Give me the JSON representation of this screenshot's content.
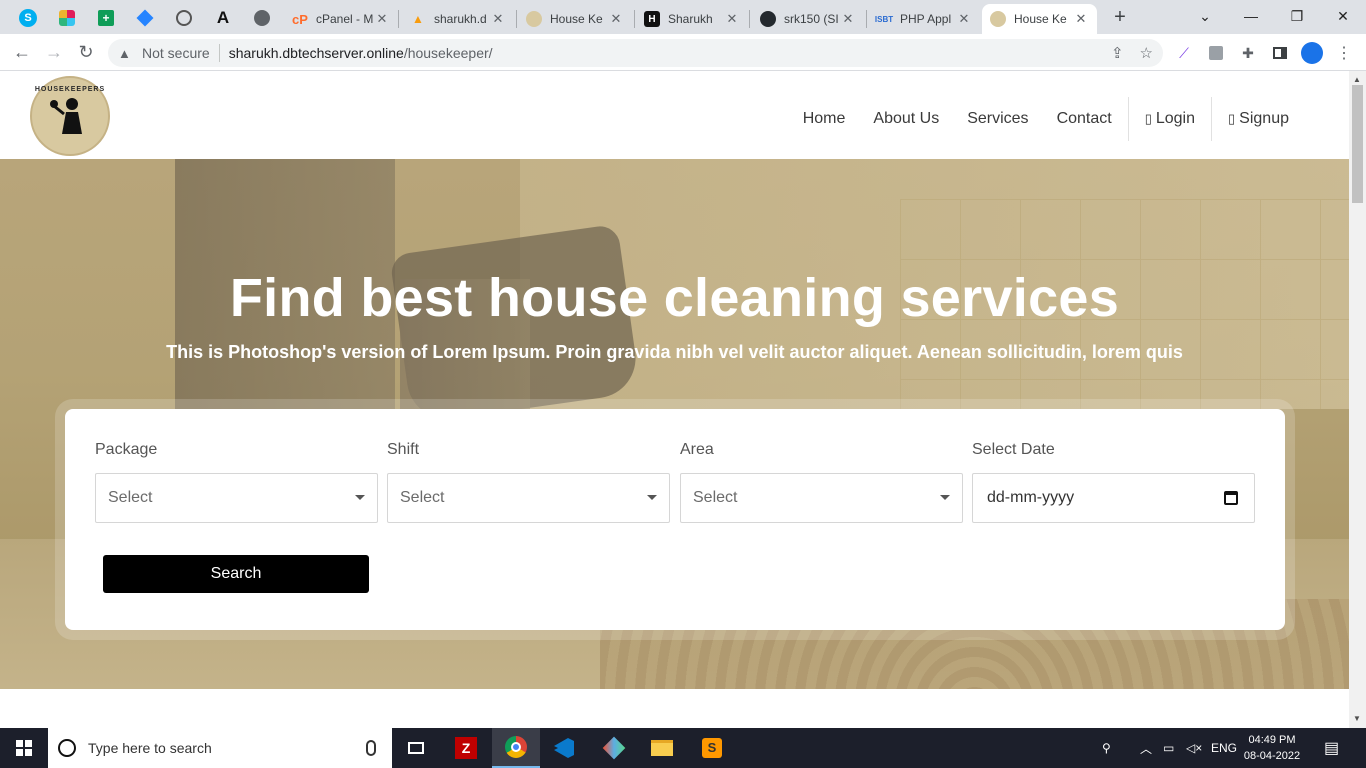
{
  "browser": {
    "tabs": [
      {
        "title": "cPanel - M",
        "icon": "cpanel-icon"
      },
      {
        "title": "sharukh.d",
        "icon": "phpmyadmin-icon"
      },
      {
        "title": "House Ke",
        "icon": "housekeeper-icon"
      },
      {
        "title": "Sharukh",
        "icon": "hashnode-icon"
      },
      {
        "title": "srk150 (SI",
        "icon": "github-icon"
      },
      {
        "title": "PHP Appl",
        "icon": "isbt-icon"
      },
      {
        "title": "House Ke",
        "icon": "housekeeper-icon",
        "active": true
      }
    ],
    "new_tab": "+",
    "security_label": "Not secure",
    "url_host": "sharukh.dbtechserver.online",
    "url_path": "/housekeeper/"
  },
  "site": {
    "logo_text": "HOUSEKEEPERS",
    "nav": {
      "home": "Home",
      "about": "About Us",
      "services": "Services",
      "contact": "Contact",
      "login": "Login",
      "signup": "Signup"
    },
    "hero": {
      "title": "Find best house cleaning services",
      "subtitle": "This is Photoshop's version of Lorem Ipsum. Proin gravida nibh vel velit auctor aliquet. Aenean sollicitudin, lorem quis"
    },
    "search_form": {
      "package_label": "Package",
      "package_value": "Select",
      "shift_label": "Shift",
      "shift_value": "Select",
      "area_label": "Area",
      "area_value": "Select",
      "date_label": "Select Date",
      "date_placeholder": "dd-mm-yyyy",
      "search_button": "Search"
    }
  },
  "taskbar": {
    "search_placeholder": "Type here to search",
    "language": "ENG",
    "time": "04:49 PM",
    "date": "08-04-2022"
  },
  "colors": {
    "hero_tint": "#b8a57a",
    "button_bg": "#000000",
    "tabstrip": "#dee1e6",
    "taskbar": "#1c1f2b"
  }
}
